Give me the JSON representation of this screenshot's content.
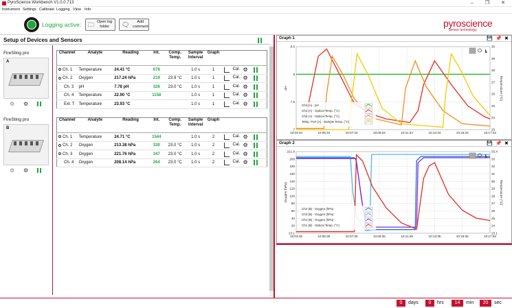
{
  "window": {
    "title": "PyroScience Workbench V1.0.0.713",
    "controls": [
      "–",
      "❐",
      "✕"
    ]
  },
  "menu": [
    "Instrument",
    "Settings",
    "Calibrate",
    "Logging",
    "View",
    "Info"
  ],
  "toolbar": {
    "logging_label": "Logging active:",
    "open_log_label": "Open log\nfolder",
    "add_comment_label": "Add\ncomment",
    "logo_text": "pyroscience",
    "logo_sub": "sensor technology"
  },
  "setup": {
    "title": "Setup of Devices and Sensors",
    "columns": [
      "Channel",
      "Analyte",
      "Reading",
      "Int.",
      "Comp.\nTemp.",
      "Sample\nInterval",
      "Graph"
    ],
    "cal_label": "Cal.",
    "devices": [
      {
        "name": "FireSting pro",
        "letter": "A",
        "rows": [
          {
            "channel": "Ch. 1",
            "radio": true,
            "analyte": "Temperature",
            "reading": "24.41 °C",
            "int": "678",
            "comp": "",
            "interval": "1.0 s",
            "graph": "1"
          },
          {
            "channel": "Ch. 2",
            "radio": true,
            "analyte": "Oxygen",
            "reading": "217.24 hPa",
            "int": "219",
            "comp": "23.9 °C",
            "interval": "1.0 s",
            "graph": "1"
          },
          {
            "channel": "Ch. 3",
            "radio": false,
            "analyte": "pH",
            "reading": "7.78 pH",
            "int": "326",
            "comp": "23.0 °C",
            "interval": "1.0 s",
            "graph": "1"
          },
          {
            "channel": "Ch. 4",
            "radio": false,
            "analyte": "Temperature",
            "reading": "22.90 °C",
            "int": "1158",
            "comp": "",
            "interval": "1.0 s",
            "graph": "1"
          },
          {
            "channel": "Ext. T",
            "radio": false,
            "analyte": "Temperature",
            "reading": "23.93 °C",
            "int": "",
            "comp": "",
            "interval": "1.0 s",
            "graph": "1"
          }
        ]
      },
      {
        "name": "FireSting pro",
        "letter": "B",
        "rows": [
          {
            "channel": "Ch. 1",
            "radio": true,
            "analyte": "Temperature",
            "reading": "24.71 °C",
            "int": "1544",
            "comp": "",
            "interval": "1.0 s",
            "graph": "2"
          },
          {
            "channel": "Ch. 2",
            "radio": true,
            "analyte": "Oxygen",
            "reading": "213.38 hPa",
            "int": "330",
            "comp": "23.0 °C",
            "interval": "1.0 s",
            "graph": "2"
          },
          {
            "channel": "Ch. 3",
            "radio": true,
            "analyte": "Oxygen",
            "reading": "221.76 hPa",
            "int": "347",
            "comp": "23.0 °C",
            "interval": "1.0 s",
            "graph": "2"
          },
          {
            "channel": "Ch. 4",
            "radio": false,
            "analyte": "Oxygen",
            "reading": "208.14 hPa",
            "int": "264",
            "comp": "23.0 °C",
            "interval": "1.0 s",
            "graph": "2"
          }
        ]
      }
    ]
  },
  "graphs": {
    "g1": {
      "title": "Graph 1",
      "icons": [
        "💾",
        "📌",
        "✖"
      ]
    },
    "g2": {
      "title": "Graph 2",
      "icons": [
        "💾",
        "📌",
        "✖"
      ]
    }
  },
  "chart_data": [
    {
      "type": "line",
      "title": "Graph 1",
      "ylabel": "pH",
      "ylabel_right": "Temperature (°C)",
      "ylim": [
        7,
        8.5
      ],
      "ylim_right": [
        23,
        30
      ],
      "y_ticks": [
        "8.5",
        "8",
        "7.5",
        "7"
      ],
      "y_ticks_right": [
        "30",
        "29",
        "28",
        "27",
        "26",
        "25",
        "24",
        "23"
      ],
      "x_ticks": [
        "10:03:34",
        "10:05:34",
        "10:07:34",
        "10:09:34",
        "10:11:34",
        "10:13:34",
        "10:15:34",
        "10:17:34"
      ],
      "series": [
        {
          "name": "Ch3 (A) - pH",
          "color": "#22bb22",
          "axis": "left",
          "x": [
            0,
            14
          ],
          "y": [
            8.0,
            8.0
          ]
        },
        {
          "name": "Ch1 (A) - Optical Temp. (°C)",
          "color": "#e8281e",
          "axis": "right",
          "x": [
            0.6,
            1.0,
            1.6,
            2.2,
            3.2,
            4.2,
            5.2,
            6.5,
            8.2,
            8.8,
            9.2,
            10.0,
            11.2,
            12.4,
            13.6,
            14
          ],
          "y": [
            23.5,
            25.8,
            29.2,
            29.8,
            27.5,
            25.2,
            24.4,
            23.9,
            23.6,
            24.6,
            26.8,
            28.8,
            26.8,
            25.0,
            24.1,
            23.9
          ]
        },
        {
          "name": "Ch4 (A) - Optical Temp. (°C)",
          "color": "#f08c1e",
          "axis": "right",
          "x": [
            0.0,
            2.0,
            2.2,
            2.6,
            3.4,
            4.2,
            5.4,
            7.6,
            7.9,
            8.6,
            9.4,
            10.6,
            12.0,
            14
          ],
          "y": [
            23.1,
            23.1,
            26.0,
            29.2,
            27.6,
            25.6,
            24.0,
            23.4,
            26.5,
            28.8,
            26.6,
            24.6,
            23.5,
            23.3
          ]
        },
        {
          "name": "Temp. Port (A) - Sample Temp. (°C)",
          "color": "#f5c800",
          "axis": "right",
          "x": [
            0.0,
            3.8,
            4.0,
            4.4,
            5.2,
            6.2,
            7.6,
            10.6,
            10.8,
            11.2,
            11.8,
            12.8,
            14
          ],
          "y": [
            23.0,
            23.0,
            25.5,
            29.4,
            27.6,
            24.8,
            23.5,
            23.2,
            26.0,
            29.4,
            28.2,
            25.8,
            24.2
          ]
        }
      ]
    },
    {
      "type": "line",
      "title": "Graph 2",
      "ylabel": "Oxygen (hPa)",
      "ylabel_right": "Temperature (°C)",
      "ylim": [
        23.1,
        221.8
      ],
      "ylim_right": [
        23.1,
        33.4
      ],
      "y_ticks": [
        "221.8",
        "200",
        "180",
        "160",
        "140",
        "120",
        "100",
        "80",
        "60",
        "40",
        "20",
        "23.1"
      ],
      "y_ticks_right": [
        "33.4",
        "33",
        "32",
        "31",
        "30",
        "29",
        "28",
        "27",
        "26",
        "25",
        "24",
        "23.1"
      ],
      "x_ticks": [
        "10:03:35",
        "10:05:35",
        "10:07:35",
        "10:09:35",
        "10:11:35",
        "10:13:35",
        "10:15:35",
        "10:17:53"
      ],
      "series": [
        {
          "name": "Ch2 (B) - Oxygen (hPa)",
          "color": "#1f6fd6",
          "axis": "left",
          "x": [
            0,
            4.2,
            4.35,
            4.7,
            5.1,
            8.6,
            8.7,
            9.0,
            14
          ],
          "y": [
            207,
            207,
            200,
            110,
            32,
            32,
            200,
            210,
            210
          ]
        },
        {
          "name": "Ch3 (B) - Oxygen (hPa)",
          "color": "#4bb8e8",
          "axis": "left",
          "x": [
            0,
            3.9,
            4.1,
            4.4,
            5.0,
            5.3,
            5.45,
            14
          ],
          "y": [
            210,
            210,
            120,
            60,
            30,
            30,
            215,
            215
          ]
        },
        {
          "name": "Ch4 (B) - Oxygen (hPa)",
          "color": "#8a2be2",
          "axis": "left",
          "x": [
            0,
            4.3,
            4.55,
            4.9,
            5.25,
            8.7,
            8.8,
            9.2,
            14
          ],
          "y": [
            205,
            205,
            150,
            65,
            38,
            38,
            195,
            207,
            207
          ]
        },
        {
          "name": "Ch1 (B) - Optical Temp. (°C)",
          "color": "#e8281e",
          "axis": "right",
          "x": [
            0,
            4.2,
            4.35,
            4.8,
            5.5,
            6.5,
            7.6,
            8.7,
            9.2,
            9.6,
            10.0,
            10.4,
            11.0,
            12.0,
            13.0,
            14
          ],
          "y": [
            23.3,
            23.3,
            33.0,
            32.2,
            29.0,
            26.3,
            24.4,
            23.6,
            30.0,
            31.6,
            32.0,
            30.4,
            28.0,
            26.0,
            25.0,
            24.7
          ]
        }
      ]
    }
  ],
  "timer": {
    "days": "0",
    "days_label": "days",
    "hrs": "0",
    "hrs_label": "hrs",
    "min": "14",
    "min_label": "min",
    "sec": "20",
    "sec_label": "sec"
  }
}
